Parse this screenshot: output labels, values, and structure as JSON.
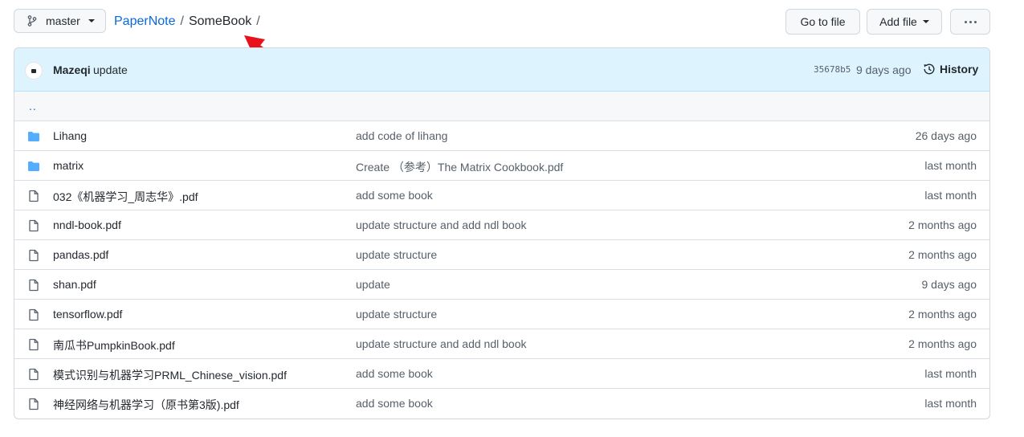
{
  "branch": {
    "label": "master",
    "icon": "git-branch-icon"
  },
  "breadcrumb": {
    "repo": "PaperNote",
    "separator": "/",
    "folder": "SomeBook",
    "trailing": "/"
  },
  "actions": {
    "go_to_file": "Go to file",
    "add_file": "Add file",
    "more": "more-icon"
  },
  "commit": {
    "author": "Mazeqi",
    "message": "update",
    "sha": "35678b5",
    "age": "9 days ago",
    "history_label": "History"
  },
  "parent_dir": "..",
  "files": [
    {
      "type": "folder",
      "name": "Lihang",
      "message": "add code of lihang",
      "age": "26 days ago"
    },
    {
      "type": "folder",
      "name": "matrix",
      "message": "Create （参考）The Matrix Cookbook.pdf",
      "age": "last month"
    },
    {
      "type": "file",
      "name": "032《机器学习_周志华》.pdf",
      "message": "add some book",
      "age": "last month"
    },
    {
      "type": "file",
      "name": "nndl-book.pdf",
      "message": "update structure and add ndl book",
      "age": "2 months ago"
    },
    {
      "type": "file",
      "name": "pandas.pdf",
      "message": "update structure",
      "age": "2 months ago"
    },
    {
      "type": "file",
      "name": "shan.pdf",
      "message": "update",
      "age": "9 days ago"
    },
    {
      "type": "file",
      "name": "tensorflow.pdf",
      "message": "update structure",
      "age": "2 months ago"
    },
    {
      "type": "file",
      "name": "南瓜书PumpkinBook.pdf",
      "message": "update structure and add ndl book",
      "age": "2 months ago"
    },
    {
      "type": "file",
      "name": "模式识别与机器学习PRML_Chinese_vision.pdf",
      "message": "add some book",
      "age": "last month"
    },
    {
      "type": "file",
      "name": "神经网络与机器学习（原书第3版).pdf",
      "message": "add some book",
      "age": "last month"
    }
  ],
  "colors": {
    "link": "#0969da",
    "folder": "#54aeff",
    "header_bg": "#ddf4ff",
    "annotation_arrow": "#e8121a"
  }
}
